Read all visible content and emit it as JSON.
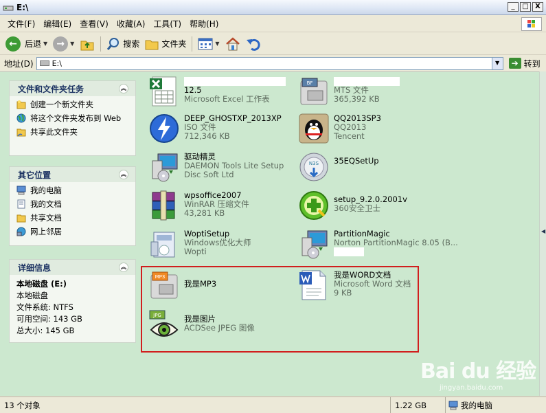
{
  "window": {
    "title": "E:\\"
  },
  "window_buttons": {
    "minimize": "_",
    "maximize": "□",
    "close": "X"
  },
  "menu": [
    "文件(F)",
    "编辑(E)",
    "查看(V)",
    "收藏(A)",
    "工具(T)",
    "帮助(H)"
  ],
  "toolbar": {
    "back_label": "后退",
    "search_label": "搜索",
    "folders_label": "文件夹"
  },
  "address": {
    "label": "地址(D)",
    "value": "E:\\",
    "go_label": "转到"
  },
  "tasks_panel": {
    "title": "文件和文件夹任务",
    "items": [
      "创建一个新文件夹",
      "将这个文件夹发布到 Web",
      "共享此文件夹"
    ]
  },
  "places_panel": {
    "title": "其它位置",
    "items": [
      "我的电脑",
      "我的文档",
      "共享文档",
      "网上邻居"
    ]
  },
  "details_panel": {
    "title": "详细信息",
    "name": "本地磁盘 (E:)",
    "type": "本地磁盘",
    "fs": "文件系统: NTFS",
    "free": "可用空间: 143 GB",
    "total": "总大小: 145 GB"
  },
  "files": [
    {
      "name": "12.5",
      "line2": "Microsoft Excel 工作表",
      "line3": ""
    },
    {
      "name": "",
      "line2": "MTS 文件",
      "line3": "365,392 KB"
    },
    {
      "name": "DEEP_GHOSTXP_2013XP",
      "line2": "ISO 文件",
      "line3": "712,346 KB"
    },
    {
      "name": "QQ2013SP3",
      "line2": "QQ2013",
      "line3": "Tencent"
    },
    {
      "name": "驱动精灵",
      "line2": "DAEMON Tools Lite Setup",
      "line3": "Disc Soft Ltd"
    },
    {
      "name": "35EQSetUp",
      "line2": "",
      "line3": ""
    },
    {
      "name": "wpsoffice2007",
      "line2": "WinRAR 压缩文件",
      "line3": "43,281 KB"
    },
    {
      "name": "setup_9.2.0.2001v",
      "line2": "360安全卫士",
      "line3": ""
    },
    {
      "name": "WoptiSetup",
      "line2": "Windows优化大师",
      "line3": "Wopti"
    },
    {
      "name": "PartitionMagic",
      "line2": "Norton PartitionMagic 8.05 (B...",
      "line3": ""
    },
    {
      "name": "我是MP3",
      "line2": "",
      "line3": ""
    },
    {
      "name": "我是WORD文档",
      "line2": "Microsoft Word 文档",
      "line3": "9 KB"
    },
    {
      "name": "我是图片",
      "line2": "ACDSee JPEG 图像",
      "line3": ""
    }
  ],
  "icon_text": {
    "mts": "BF",
    "mp3": "MP3",
    "jpg": "JPG",
    "n360": "N3S"
  },
  "watermark": {
    "logo": "Bai du 经验",
    "url": "jingyan.baidu.com"
  },
  "status": {
    "objects": "13 个对象",
    "size": "1.22 GB",
    "location": "我的电脑"
  }
}
